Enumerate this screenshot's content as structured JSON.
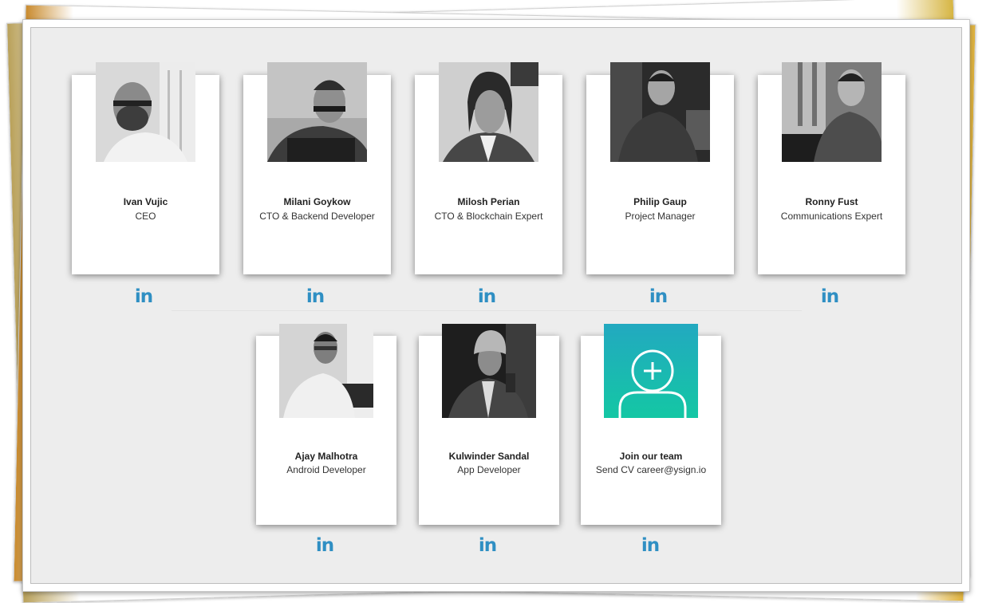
{
  "team": {
    "members": [
      {
        "name": "Ivan Vujic",
        "role": "CEO",
        "linkedin": "in"
      },
      {
        "name": "Milani Goykow",
        "role": "CTO & Backend Developer",
        "linkedin": "in"
      },
      {
        "name": "Milosh Perian",
        "role": "CTO & Blockchain Expert",
        "linkedin": "in"
      },
      {
        "name": "Philip Gaup",
        "role": "Project Manager",
        "linkedin": "in"
      },
      {
        "name": "Ronny Fust",
        "role": "Communications Expert",
        "linkedin": "in"
      },
      {
        "name": "Ajay Malhotra",
        "role": "Android Developer",
        "linkedin": "in"
      },
      {
        "name": "Kulwinder Sandal",
        "role": "App Developer",
        "linkedin": "in"
      }
    ],
    "join": {
      "name": "Join our team",
      "role": "Send CV career@ysign.io",
      "linkedin": "in",
      "icon": "add-user-icon"
    }
  },
  "colors": {
    "linkedin": "#2f8fc3",
    "join_gradient_top": "#22a9c0",
    "join_gradient_bottom": "#14c7a4"
  }
}
